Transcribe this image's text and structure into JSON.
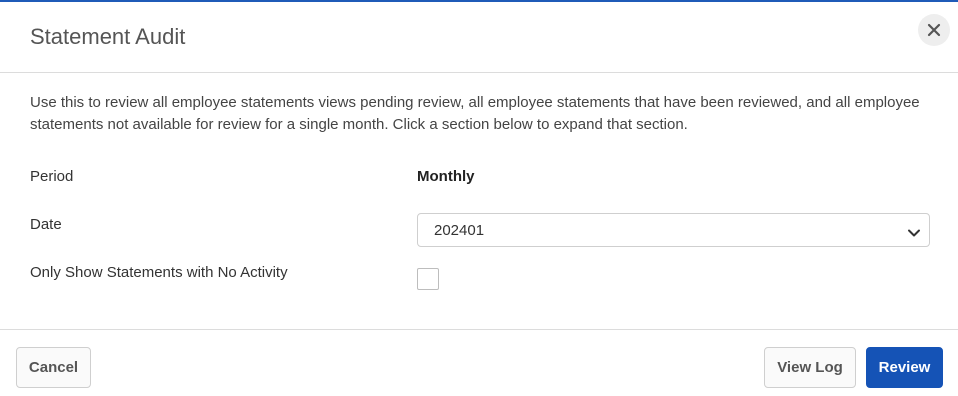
{
  "dialog": {
    "title": "Statement Audit",
    "description": "Use this to review all employee statements views pending review, all employee statements that have been reviewed, and all employee statements not available for review for a single month. Click a section below to expand that section."
  },
  "form": {
    "period_label": "Period",
    "period_value": "Monthly",
    "date_label": "Date",
    "date_value": "202401",
    "no_activity_label": "Only Show Statements with No Activity",
    "no_activity_checked": false
  },
  "footer": {
    "cancel_label": "Cancel",
    "view_log_label": "View Log",
    "review_label": "Review"
  },
  "icons": {
    "close": "close-icon",
    "chevron": "chevron-down-icon"
  },
  "colors": {
    "accent": "#1553b6",
    "top_border": "#1f5bb8"
  }
}
